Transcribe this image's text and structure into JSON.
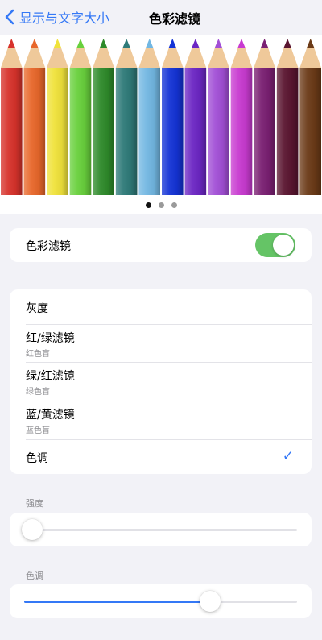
{
  "nav": {
    "back_label": "显示与文字大小",
    "title": "色彩滤镜"
  },
  "preview": {
    "pencil_colors": [
      "#d7322b",
      "#e8672a",
      "#f0e23a",
      "#68d03c",
      "#2e8a2a",
      "#2e7a78",
      "#72b7e2",
      "#1433d6",
      "#6c26c4",
      "#a24fd6",
      "#c83ad0",
      "#7a1f72",
      "#5a1530",
      "#6b3a17"
    ],
    "page_count": 3,
    "active_page": 0
  },
  "toggle": {
    "label": "色彩滤镜",
    "on": true,
    "on_color": "#65c466"
  },
  "filters": [
    {
      "title": "灰度",
      "subtitle": ""
    },
    {
      "title": "红/绿滤镜",
      "subtitle": "红色盲"
    },
    {
      "title": "绿/红滤镜",
      "subtitle": "绿色盲"
    },
    {
      "title": "蓝/黄滤镜",
      "subtitle": "蓝色盲"
    },
    {
      "title": "色调",
      "subtitle": "",
      "checkmark": "✓"
    }
  ],
  "intensity": {
    "label": "强度",
    "value": 0.03
  },
  "hue": {
    "label": "色调",
    "value": 0.68
  },
  "accent_color": "#3478f6"
}
